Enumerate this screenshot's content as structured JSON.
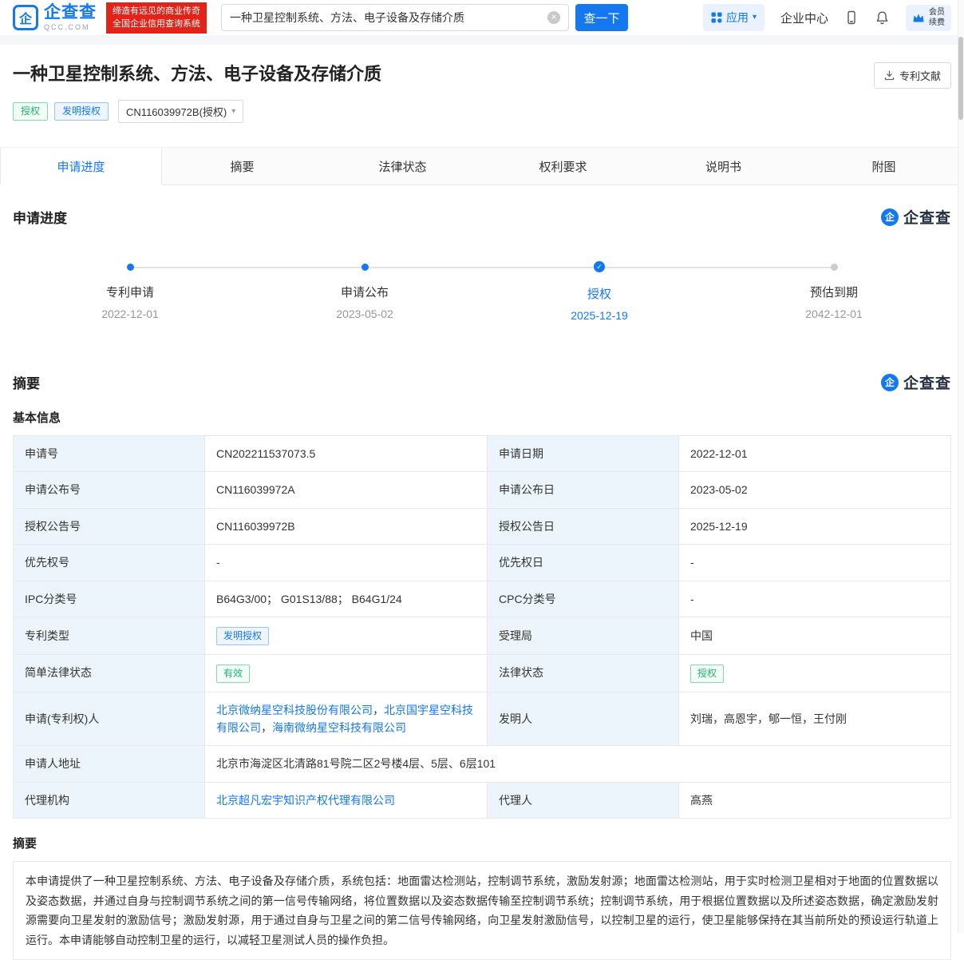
{
  "colors": {
    "accent": "#1478f0",
    "status_green": "#21b573",
    "brand_red": "#e2231a"
  },
  "header": {
    "logo": {
      "icon_char": "企",
      "name_cn": "企查查",
      "name_en": "QCC.COM"
    },
    "slogan": {
      "line1": "缔造有远见的商业传奇",
      "line2": "全国企业信用查询系统"
    },
    "search": {
      "value": "一种卫星控制系统、方法、电子设备及存储介质",
      "button": "查一下"
    },
    "nav": {
      "app": "应用",
      "enterprise_center": "企业中心",
      "vip_line1": "会员",
      "vip_line2": "续费"
    }
  },
  "patent_header": {
    "title": "一种卫星控制系统、方法、电子设备及存储介质",
    "doc_button": "专利文献",
    "tags": [
      {
        "label": "授权",
        "color": "green"
      },
      {
        "label": "发明授权",
        "color": "blue"
      }
    ],
    "version_select": "CN116039972B(授权)"
  },
  "tabs": [
    {
      "label": "申请进度",
      "active": true
    },
    {
      "label": "摘要",
      "active": false
    },
    {
      "label": "法律状态",
      "active": false
    },
    {
      "label": "权利要求",
      "active": false
    },
    {
      "label": "说明书",
      "active": false
    },
    {
      "label": "附图",
      "active": false
    }
  ],
  "progress": {
    "heading": "申请进度",
    "watermark": "企查查",
    "timeline": [
      {
        "label": "专利申请",
        "date": "2022-12-01",
        "state": "done"
      },
      {
        "label": "申请公布",
        "date": "2023-05-02",
        "state": "done"
      },
      {
        "label": "授权",
        "date": "2025-12-19",
        "state": "current"
      },
      {
        "label": "预估到期",
        "date": "2042-12-01",
        "state": "future"
      }
    ]
  },
  "summary": {
    "heading": "摘要",
    "watermark": "企查查",
    "basic_info_heading": "基本信息",
    "abstract_heading": "摘要",
    "table_rows": [
      [
        {
          "type": "label",
          "text": "申请号"
        },
        {
          "type": "text",
          "text": "CN202211537073.5"
        },
        {
          "type": "label",
          "text": "申请日期"
        },
        {
          "type": "text",
          "text": "2022-12-01"
        }
      ],
      [
        {
          "type": "label",
          "text": "申请公布号"
        },
        {
          "type": "text",
          "text": "CN116039972A"
        },
        {
          "type": "label",
          "text": "申请公布日"
        },
        {
          "type": "text",
          "text": "2023-05-02"
        }
      ],
      [
        {
          "type": "label",
          "text": "授权公告号"
        },
        {
          "type": "text",
          "text": "CN116039972B"
        },
        {
          "type": "label",
          "text": "授权公告日"
        },
        {
          "type": "text",
          "text": "2025-12-19"
        }
      ],
      [
        {
          "type": "label",
          "text": "优先权号"
        },
        {
          "type": "text",
          "text": "-"
        },
        {
          "type": "label",
          "text": "优先权日"
        },
        {
          "type": "text",
          "text": "-"
        }
      ],
      [
        {
          "type": "label",
          "text": "IPC分类号"
        },
        {
          "type": "text",
          "text": "B64G3/00； G01S13/88； B64G1/24"
        },
        {
          "type": "label",
          "text": "CPC分类号"
        },
        {
          "type": "text",
          "text": "-"
        }
      ],
      [
        {
          "type": "label",
          "text": "专利类型"
        },
        {
          "type": "tag",
          "color": "blue",
          "text": "发明授权"
        },
        {
          "type": "label",
          "text": "受理局"
        },
        {
          "type": "text",
          "text": "中国"
        }
      ],
      [
        {
          "type": "label",
          "text": "简单法律状态"
        },
        {
          "type": "tag",
          "color": "green",
          "text": "有效"
        },
        {
          "type": "label",
          "text": "法律状态"
        },
        {
          "type": "tag",
          "color": "green",
          "text": "授权"
        }
      ],
      [
        {
          "type": "label",
          "text": "申请(专利权)人"
        },
        {
          "type": "links",
          "texts": [
            "北京微纳星空科技股份有限公司",
            "北京国宇星空科技有限公司",
            "海南微纳星空科技有限公司"
          ],
          "separator": "，"
        },
        {
          "type": "label",
          "text": "发明人"
        },
        {
          "type": "text",
          "text": "刘瑞，高恩宇，郇一恒，王付刚"
        }
      ],
      [
        {
          "type": "label",
          "text": "申请人地址"
        },
        {
          "type": "text",
          "colspan": 3,
          "text": "北京市海淀区北清路81号院二区2号楼4层、5层、6层101"
        }
      ],
      [
        {
          "type": "label",
          "text": "代理机构"
        },
        {
          "type": "links",
          "texts": [
            "北京超凡宏宇知识产权代理有限公司"
          ],
          "separator": "，"
        },
        {
          "type": "label",
          "text": "代理人"
        },
        {
          "type": "text",
          "text": "高燕"
        }
      ]
    ],
    "abstract_text": "本申请提供了一种卫星控制系统、方法、电子设备及存储介质，系统包括：地面雷达检测站，控制调节系统，激励发射源；地面雷达检测站，用于实时检测卫星相对于地面的位置数据以及姿态数据，并通过自身与控制调节系统之间的第一信号传输网络，将位置数据以及姿态数据传输至控制调节系统；控制调节系统，用于根据位置数据以及所述姿态数据，确定激励发射源需要向卫星发射的激励信号；激励发射源，用于通过自身与卫星之间的第二信号传输网络，向卫星发射激励信号，以控制卫星的运行，使卫星能够保持在其当前所处的预设运行轨道上运行。本申请能够自动控制卫星的运行，以减轻卫星测试人员的操作负担。"
  }
}
